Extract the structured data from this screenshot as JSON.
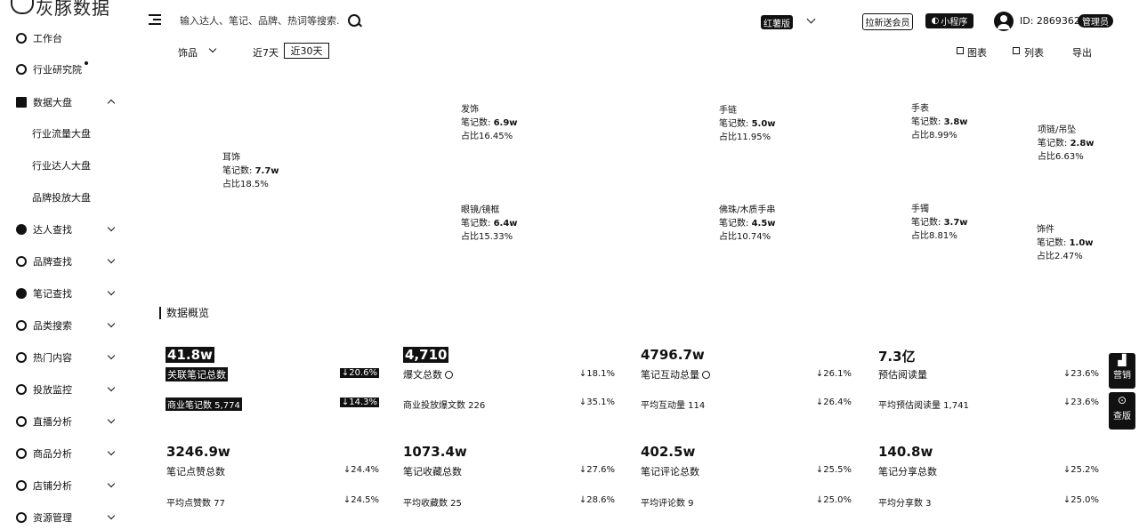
{
  "sidebar": {
    "logo_text": "灰豚数据",
    "items": [
      {
        "label": "工作台"
      },
      {
        "label": "行业研究院"
      },
      {
        "label": "数据大盘"
      },
      {
        "label": "行业流量大盘"
      },
      {
        "label": "行业达人大盘"
      },
      {
        "label": "品牌投放大盘"
      },
      {
        "label": "达人查找"
      },
      {
        "label": "品牌查找"
      },
      {
        "label": "笔记查找"
      },
      {
        "label": "品类搜索"
      },
      {
        "label": "热门内容"
      },
      {
        "label": "投放监控"
      },
      {
        "label": "直播分析"
      },
      {
        "label": "商品分析"
      },
      {
        "label": "店铺分析"
      },
      {
        "label": "资源管理"
      }
    ]
  },
  "header": {
    "search_placeholder": "输入达人、笔记、品牌、热词等搜索...",
    "platform": "红薯版",
    "new_member_button": "拉新送会员",
    "mini_program_button": "小程序",
    "user_id": "ID: 2869362",
    "manage_badge": "管理员"
  },
  "filters": {
    "category": "饰品",
    "range_7": "近7天",
    "range_30": "近30天",
    "view_chart": "图表",
    "view_list": "列表",
    "export": "导出"
  },
  "treemap": {
    "cells": [
      {
        "name": "耳饰",
        "count_label": "笔记数:",
        "count": "7.7w",
        "share": "占比18.5%"
      },
      {
        "name": "发饰",
        "count_label": "笔记数:",
        "count": "6.9w",
        "share": "占比16.45%"
      },
      {
        "name": "眼镜/镜框",
        "count_label": "笔记数:",
        "count": "6.4w",
        "share": "占比15.33%"
      },
      {
        "name": "手链",
        "count_label": "笔记数:",
        "count": "5.0w",
        "share": "占比11.95%"
      },
      {
        "name": "佛珠/木质手串",
        "count_label": "笔记数:",
        "count": "4.5w",
        "share": "占比10.74%"
      },
      {
        "name": "手表",
        "count_label": "笔记数:",
        "count": "3.8w",
        "share": "占比8.99%"
      },
      {
        "name": "手镯",
        "count_label": "笔记数:",
        "count": "3.7w",
        "share": "占比8.81%"
      },
      {
        "name": "项链/吊坠",
        "count_label": "笔记数:",
        "count": "2.8w",
        "share": "占比6.63%"
      },
      {
        "name": "饰件",
        "count_label": "笔记数:",
        "count": "1.0w",
        "share": "占比2.47%"
      }
    ]
  },
  "overview": {
    "title": "数据概览",
    "metrics": [
      {
        "value": "41.8w",
        "label": "关联笔记总数",
        "pct": "↓20.6%",
        "sub": "商业笔记数 5,774",
        "sub_pct": "↓14.3%"
      },
      {
        "value": "4,710",
        "label": "爆文总数",
        "pct": "↓18.1%",
        "sub": "商业投放爆文数 226",
        "sub_pct": "↓35.1%"
      },
      {
        "value": "4796.7w",
        "label": "笔记互动总量",
        "pct": "↓26.1%",
        "sub": "平均互动量 114",
        "sub_pct": "↓26.4%"
      },
      {
        "value": "7.3亿",
        "label": "预估阅读量",
        "pct": "↓23.6%",
        "sub": "平均预估阅读量 1,741",
        "sub_pct": "↓23.6%"
      },
      {
        "value": "3246.9w",
        "label": "笔记点赞总数",
        "pct": "↓24.4%",
        "sub": "平均点赞数 77",
        "sub_pct": "↓24.5%"
      },
      {
        "value": "1073.4w",
        "label": "笔记收藏总数",
        "pct": "↓27.6%",
        "sub": "平均收藏数 25",
        "sub_pct": "↓28.6%"
      },
      {
        "value": "402.5w",
        "label": "笔记评论总数",
        "pct": "↓25.5%",
        "sub": "平均评论数 9",
        "sub_pct": "↓25.0%"
      },
      {
        "value": "140.8w",
        "label": "笔记分享总数",
        "pct": "↓25.2%",
        "sub": "平均分享数 3",
        "sub_pct": "↓25.0%"
      }
    ]
  },
  "floating": {
    "btn1": "营销",
    "btn2": "查版"
  }
}
